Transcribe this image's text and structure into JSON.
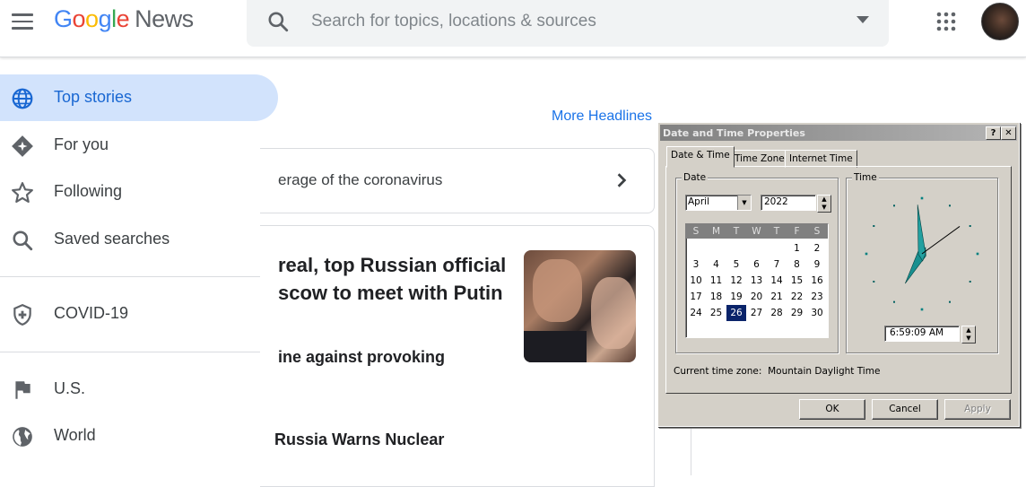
{
  "app": {
    "logo_google": "Google",
    "logo_news": "News",
    "brand_colors": {
      "blue": "#4285F4",
      "red": "#EA4335",
      "yellow": "#FBBC05",
      "green": "#34A853"
    }
  },
  "header": {
    "search_placeholder": "Search for topics, locations & sources",
    "icons": [
      "menu-icon",
      "search-icon",
      "dropdown-icon",
      "apps-icon",
      "avatar"
    ]
  },
  "sidebar": {
    "items": [
      {
        "label": "Top stories",
        "icon": "globe-icon",
        "active": true
      },
      {
        "label": "For you",
        "icon": "diamond-icon",
        "active": false
      },
      {
        "label": "Following",
        "icon": "star-icon",
        "active": false
      },
      {
        "label": "Saved searches",
        "icon": "search-icon",
        "active": false
      },
      {
        "label": "COVID-19",
        "icon": "shield-icon",
        "active": false
      },
      {
        "label": "U.S.",
        "icon": "flag-icon",
        "active": false
      },
      {
        "label": "World",
        "icon": "world-icon",
        "active": false
      }
    ]
  },
  "main": {
    "more_headlines": "More Headlines",
    "covid_card_text": "erage of the coronavirus",
    "headline_1": "real, top Russian official scow to meet with Putin",
    "headline_2": "ine against provoking",
    "headline_3": "Russia Warns Nuclear"
  },
  "dialog": {
    "title": "Date and Time Properties",
    "help_button": "?",
    "close_button": "✕",
    "tabs": [
      "Date & Time",
      "Time Zone",
      "Internet Time"
    ],
    "active_tab": "Date & Time",
    "date_group": "Date",
    "time_group": "Time",
    "month": "April",
    "year": "2022",
    "weekdays": [
      "S",
      "M",
      "T",
      "W",
      "T",
      "F",
      "S"
    ],
    "weeks": [
      [
        "",
        "",
        "",
        "",
        "",
        "1",
        "2"
      ],
      [
        "3",
        "4",
        "5",
        "6",
        "7",
        "8",
        "9"
      ],
      [
        "10",
        "11",
        "12",
        "13",
        "14",
        "15",
        "16"
      ],
      [
        "17",
        "18",
        "19",
        "20",
        "21",
        "22",
        "23"
      ],
      [
        "24",
        "25",
        "26",
        "27",
        "28",
        "29",
        "30"
      ]
    ],
    "selected_day": "26",
    "time": "6:59:09 AM",
    "clock": {
      "hours": 6,
      "minutes": 59,
      "seconds": 9
    },
    "timezone_label": "Current time zone:",
    "timezone_value": "Mountain Daylight Time",
    "ok": "OK",
    "cancel": "Cancel",
    "apply": "Apply"
  }
}
